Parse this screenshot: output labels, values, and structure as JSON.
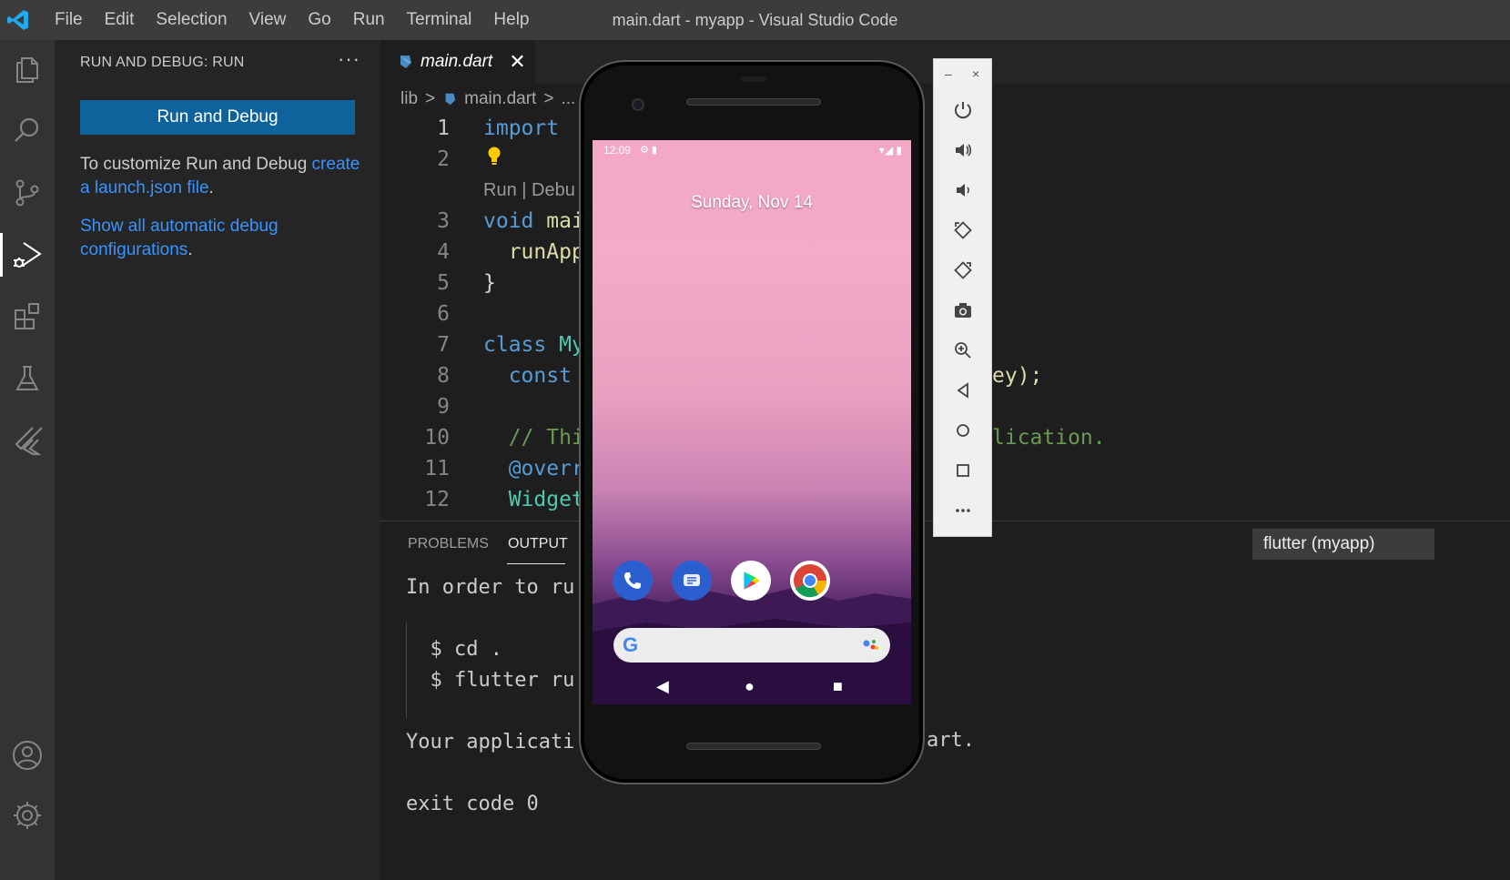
{
  "titlebar": {
    "menu": [
      "File",
      "Edit",
      "Selection",
      "View",
      "Go",
      "Run",
      "Terminal",
      "Help"
    ],
    "title": "main.dart - myapp - Visual Studio Code"
  },
  "activity": {
    "items": [
      "explorer-icon",
      "search-icon",
      "source-control-icon",
      "run-debug-icon",
      "extensions-icon",
      "testing-icon",
      "flutter-icon",
      "account-icon",
      "settings-gear-icon"
    ],
    "active": "run-debug-icon"
  },
  "sidebar": {
    "header": "RUN AND DEBUG: RUN",
    "more": "···",
    "run_button": "Run and Debug",
    "customize_text": "To customize Run and Debug ",
    "customize_link": "create a launch.json file",
    "customize_end": ".",
    "show_all_link": "Show all automatic debug configurations",
    "show_all_end": "."
  },
  "editor": {
    "tab_label": "main.dart",
    "tab_close": "✕",
    "breadcrumb": [
      "lib",
      ">",
      "main.dart",
      ">",
      "..."
    ],
    "codelens": "Run | Debu",
    "lines": [
      {
        "n": "1",
        "parts": [
          {
            "c": "kw",
            "t": "import"
          }
        ]
      },
      {
        "n": "2",
        "parts": []
      },
      {
        "n": "3",
        "parts": [
          {
            "c": "kw",
            "t": "void"
          },
          {
            "c": "pl",
            "t": " "
          },
          {
            "c": "fn",
            "t": "mai"
          }
        ]
      },
      {
        "n": "4",
        "parts": [
          {
            "c": "pl",
            "t": "  "
          },
          {
            "c": "fn",
            "t": "runApp"
          }
        ]
      },
      {
        "n": "5",
        "parts": [
          {
            "c": "pl",
            "t": "}"
          }
        ]
      },
      {
        "n": "6",
        "parts": []
      },
      {
        "n": "7",
        "parts": [
          {
            "c": "kw",
            "t": "class"
          },
          {
            "c": "pl",
            "t": " "
          },
          {
            "c": "cls",
            "t": "My"
          }
        ]
      },
      {
        "n": "8",
        "parts": [
          {
            "c": "pl",
            "t": "  "
          },
          {
            "c": "kw",
            "t": "const"
          }
        ]
      },
      {
        "n": "9",
        "parts": []
      },
      {
        "n": "10",
        "parts": [
          {
            "c": "pl",
            "t": "  "
          },
          {
            "c": "cm",
            "t": "// Thi"
          }
        ]
      },
      {
        "n": "11",
        "parts": [
          {
            "c": "pl",
            "t": "  "
          },
          {
            "c": "kw",
            "t": "@overr"
          }
        ]
      },
      {
        "n": "12",
        "parts": [
          {
            "c": "pl",
            "t": "  "
          },
          {
            "c": "cls",
            "t": "Widget"
          }
        ]
      }
    ],
    "right_line8": "ey);",
    "right_line10": "lication."
  },
  "panel": {
    "tabs": [
      "PROBLEMS",
      "OUTPUT"
    ],
    "active_tab": "OUTPUT",
    "channel": "flutter (myapp)",
    "output": [
      "In order to ru",
      "",
      "  $ cd .",
      "  $ flutter ru",
      "",
      "Your applicati",
      "",
      "exit code 0"
    ],
    "output_right": "art."
  },
  "emulator": {
    "time": "12:09",
    "date": "Sunday, Nov 14",
    "apps": [
      "phone-icon",
      "messages-icon",
      "play-store-icon",
      "chrome-icon"
    ],
    "nav": [
      "◀",
      "●",
      "■"
    ],
    "toolbar": [
      "power-icon",
      "volume-up-icon",
      "volume-down-icon",
      "rotate-left-icon",
      "rotate-right-icon",
      "screenshot-icon",
      "zoom-icon",
      "back-icon",
      "home-icon",
      "overview-icon",
      "more-icon"
    ],
    "window_min": "–",
    "window_close": "×"
  },
  "colors": {
    "accent": "#0e639c",
    "link": "#3794ff",
    "keyword": "#569cd6",
    "function": "#dcdcaa",
    "class": "#4ec9b0",
    "comment": "#6a9955"
  }
}
